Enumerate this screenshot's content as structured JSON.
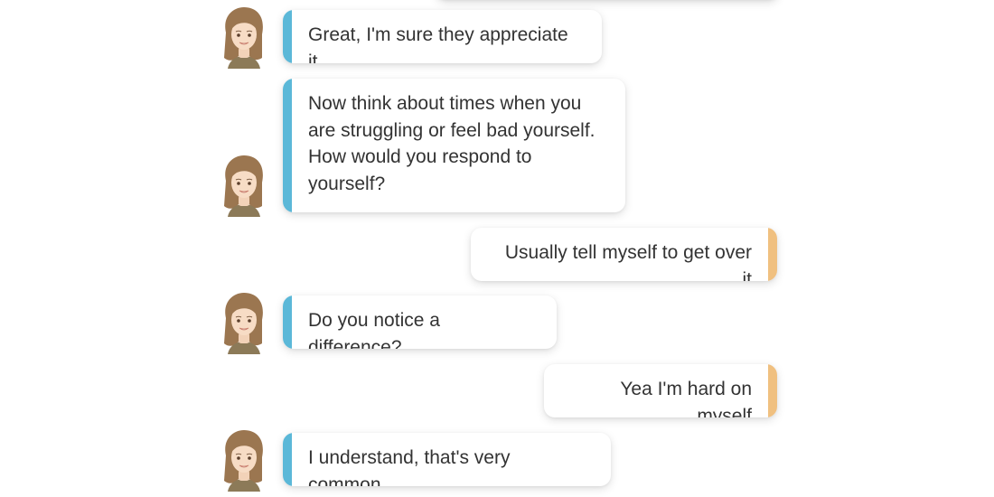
{
  "colors": {
    "bot_accent": "#5bb8d8",
    "user_accent": "#f0c080",
    "text": "#333333",
    "background": "#ffffff"
  },
  "chat": {
    "messages": [
      {
        "sender": "bot",
        "text": "Great, I'm sure they appreciate it",
        "avatar_icon": "female-coach-avatar-icon"
      },
      {
        "sender": "bot",
        "text": "Now think about times when you\nare struggling or feel bad yourself.\nHow would you respond to\nyourself?",
        "avatar_icon": "female-coach-avatar-icon"
      },
      {
        "sender": "user",
        "text": "Usually tell myself to get over it"
      },
      {
        "sender": "bot",
        "text": "Do you notice a difference?",
        "avatar_icon": "female-coach-avatar-icon"
      },
      {
        "sender": "user",
        "text": "Yea I'm hard on myself"
      },
      {
        "sender": "bot",
        "text": "I understand, that's very common.",
        "avatar_icon": "female-coach-avatar-icon"
      }
    ]
  }
}
